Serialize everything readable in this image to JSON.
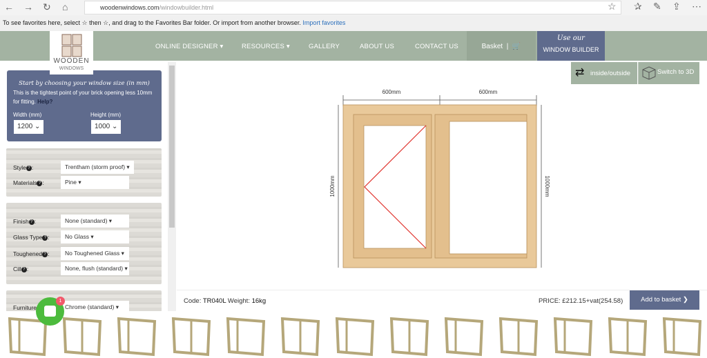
{
  "browser": {
    "url_domain": "woodenwindows.com",
    "url_path": "/windowbuilder.html",
    "favorites_text": "To see favorites here, select ☆ then ☆, and drag to the Favorites Bar folder. Or import from another browser.",
    "import_link": "Import favorites"
  },
  "nav": {
    "logo_top": "WOODEN",
    "logo_bottom": "WINDOWS",
    "items": [
      "ONLINE DESIGNER ▾",
      "RESOURCES ▾",
      "GALLERY",
      "ABOUT US",
      "CONTACT US"
    ],
    "basket": "Basket",
    "builder_top": "Use our",
    "builder_bottom": "WINDOW BUILDER"
  },
  "size": {
    "title": "Start by choosing your window size (in mm)",
    "desc": "This is the tightest point of your brick opening less 10mm for fitting.",
    "help": "Help?",
    "width_label": "Width (mm)",
    "width_value": "1200",
    "height_label": "Height (mm)",
    "height_value": "1000"
  },
  "options": [
    {
      "label": "Style",
      "value": "Trentham (storm proof) ▾"
    },
    {
      "label": "Materials",
      "value": "Pine ▾"
    },
    {
      "label": "Finish",
      "value": "None (standard) ▾"
    },
    {
      "label": "Glass Type",
      "value": "No Glass ▾"
    },
    {
      "label": "Toughened",
      "value": "No Toughened Glass ▾"
    },
    {
      "label": "Cill",
      "value": "None, flush (standard) ▾"
    },
    {
      "label": "Furniture",
      "value": "Chrome (standard) ▾"
    }
  ],
  "view": {
    "inside_outside": "inside/outside",
    "switch3d": "Switch to 3D"
  },
  "drawing": {
    "left_width": "600mm",
    "right_width": "600mm",
    "left_height": "1000mm",
    "right_height": "1000mm",
    "frame_color": "#e9c99a",
    "opener_color": "#e0302a"
  },
  "footer": {
    "code_label": "Code:",
    "code": "TR040L",
    "weight_label": "Weight:",
    "weight": "16kg",
    "price": "PRICE: £212.15+vat(254.58)",
    "add": "Add to basket ❯"
  },
  "chat": {
    "badge": "1"
  }
}
